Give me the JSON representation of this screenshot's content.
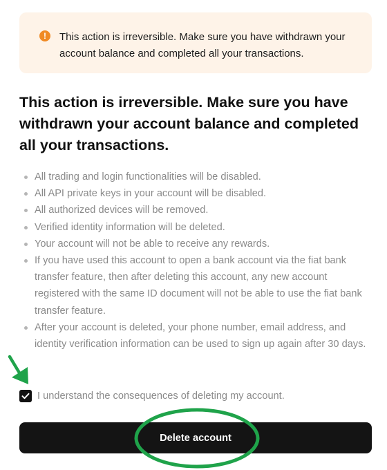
{
  "warning_banner": {
    "icon": "exclamation-circle-icon",
    "text": "This action is irreversible. Make sure you have withdrawn your account balance and completed all your transactions.",
    "background_color": "#FEF3E8",
    "icon_color": "#F08A24"
  },
  "heading": "This action is irreversible. Make sure you have withdrawn your account balance and completed all your transactions.",
  "consequences": [
    "All trading and login functionalities will be disabled.",
    "All API private keys in your account will be disabled.",
    "All authorized devices will be removed.",
    "Verified identity information will be deleted.",
    "Your account will not be able to receive any rewards.",
    "If you have used this account to open a bank account via the fiat bank transfer feature, then after deleting this account, any new account registered with the same ID document will not be able to use the fiat bank transfer feature.",
    "After your account is deleted, your phone number, email address, and identity verification information can be used to sign up again after 30 days."
  ],
  "acknowledgement": {
    "label": "I understand the consequences of deleting my account.",
    "checked": true
  },
  "delete_button": {
    "label": "Delete account",
    "background_color": "#141414"
  },
  "annotations": {
    "color": "#1FA34A",
    "arrow": "arrow-down-right-icon",
    "ellipse": "highlight-ellipse"
  }
}
